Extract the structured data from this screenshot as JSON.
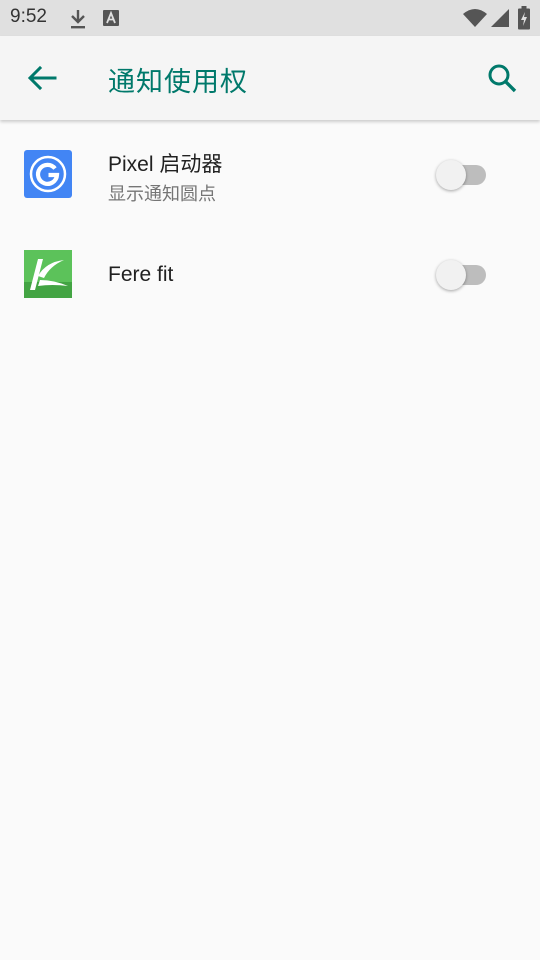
{
  "status_bar": {
    "time": "9:52",
    "icons": [
      "download-icon",
      "text-a-icon",
      "wifi-icon",
      "signal-icon",
      "battery-charging-icon"
    ]
  },
  "app_bar": {
    "title": "通知使用权",
    "back_icon": "arrow-back-icon",
    "search_icon": "search-icon",
    "accent_color": "#00796b"
  },
  "apps": [
    {
      "title": "Pixel 启动器",
      "summary": "显示通知圆点",
      "icon": "pixel-launcher-icon",
      "enabled": false
    },
    {
      "title": "Fere fit",
      "summary": "",
      "icon": "fere-fit-icon",
      "enabled": false
    }
  ]
}
